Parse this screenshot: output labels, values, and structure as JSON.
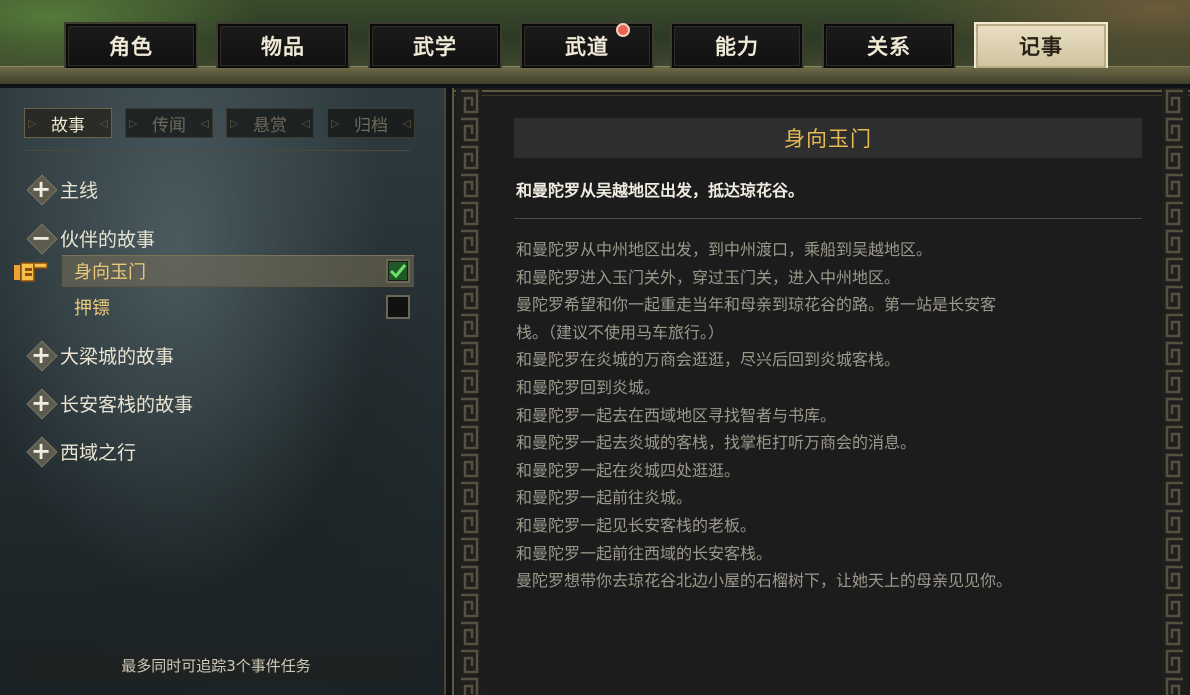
{
  "tabs": [
    {
      "label": "角色",
      "active": false,
      "badge": false
    },
    {
      "label": "物品",
      "active": false,
      "badge": false
    },
    {
      "label": "武学",
      "active": false,
      "badge": false
    },
    {
      "label": "武道",
      "active": false,
      "badge": true
    },
    {
      "label": "能力",
      "active": false,
      "badge": false
    },
    {
      "label": "关系",
      "active": false,
      "badge": false
    },
    {
      "label": "记事",
      "active": true,
      "badge": false
    }
  ],
  "subtabs": [
    {
      "label": "故事",
      "active": true
    },
    {
      "label": "传闻",
      "active": false
    },
    {
      "label": "悬赏",
      "active": false
    },
    {
      "label": "归档",
      "active": false
    }
  ],
  "tree": {
    "main_line": {
      "icon": "plus-icon",
      "label": "主线"
    },
    "companion": {
      "icon": "minus-icon",
      "label": "伙伴的故事",
      "children": [
        {
          "label": "身向玉门",
          "selected": true,
          "tracked": true
        },
        {
          "label": "押镖",
          "selected": false,
          "tracked": false
        }
      ]
    },
    "daliang": {
      "icon": "plus-icon",
      "label": "大梁城的故事"
    },
    "changan": {
      "icon": "plus-icon",
      "label": "长安客栈的故事"
    },
    "western": {
      "icon": "plus-icon",
      "label": "西域之行"
    }
  },
  "footer_note": "最多同时可追踪3个事件任务",
  "detail": {
    "title": "身向玉门",
    "summary": "和曼陀罗从吴越地区出发，抵达琼花谷。",
    "log": [
      "和曼陀罗从中州地区出发，到中州渡口，乘船到吴越地区。",
      "和曼陀罗进入玉门关外，穿过玉门关，进入中州地区。",
      "曼陀罗希望和你一起重走当年和母亲到琼花谷的路。第一站是长安客",
      "栈。（建议不使用马车旅行。）",
      "和曼陀罗在炎城的万商会逛逛，尽兴后回到炎城客栈。",
      "和曼陀罗回到炎城。",
      "和曼陀罗一起去在西域地区寻找智者与书库。",
      "和曼陀罗一起去炎城的客栈，找掌柜打听万商会的消息。",
      "和曼陀罗一起在炎城四处逛逛。",
      "和曼陀罗一起前往炎城。",
      "和曼陀罗一起见长安客栈的老板。",
      "和曼陀罗一起前往西域的长安客栈。",
      "曼陀罗想带你去琼花谷北边小屋的石榴树下，让她天上的母亲见见你。"
    ]
  },
  "colors": {
    "title_gold": "#e9b955",
    "selected_item": "#e9c97a",
    "check_green": "#3ec24a",
    "badge_red": "#e8645a"
  }
}
